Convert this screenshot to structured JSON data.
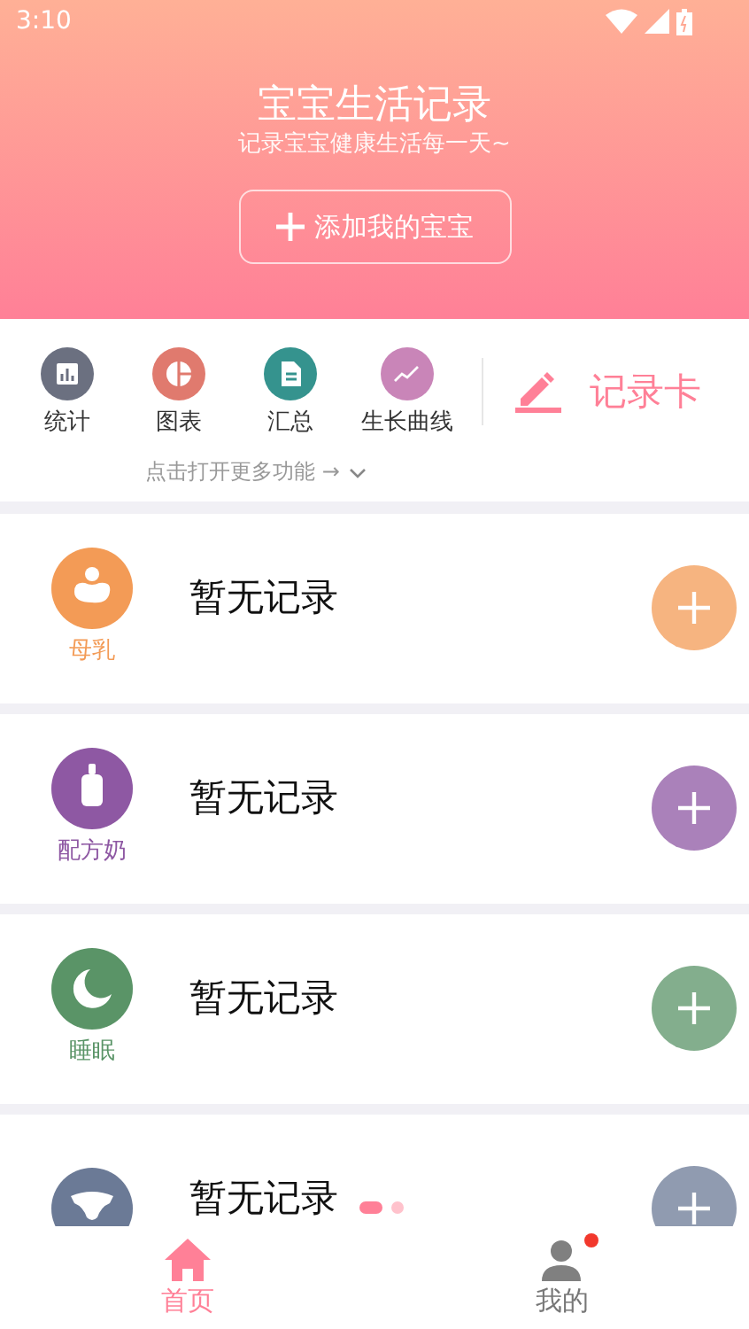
{
  "status_bar": {
    "time": "3:10"
  },
  "header": {
    "title": "宝宝生活记录",
    "subtitle": "记录宝宝健康生活每一天~",
    "add_button": "添加我的宝宝"
  },
  "functions": [
    {
      "label": "统计",
      "kind": "stats",
      "color": "#6b7080"
    },
    {
      "label": "图表",
      "kind": "pie",
      "color": "#e07a6e"
    },
    {
      "label": "汇总",
      "kind": "doc",
      "color": "#35938e"
    },
    {
      "label": "生长曲线",
      "kind": "curve",
      "color": "#c985b8"
    }
  ],
  "record_card": {
    "label": "记录卡"
  },
  "more_hint": "点击打开更多功能 →",
  "records": [
    {
      "kind": "breast",
      "label": "母乳",
      "text": "暂无记录",
      "color": "#f39b56"
    },
    {
      "kind": "formula",
      "label": "配方奶",
      "text": "暂无记录",
      "color": "#8e58a3"
    },
    {
      "kind": "sleep",
      "label": "睡眠",
      "text": "暂无记录",
      "color": "#5a9467"
    },
    {
      "kind": "diaper",
      "text": "暂无记录",
      "color": "#6b7a96"
    }
  ],
  "pager": [
    {
      "selected": true
    },
    {
      "selected": false
    }
  ],
  "nav": [
    {
      "label": "首页",
      "kind": "home",
      "selected": true,
      "badge": false
    },
    {
      "label": "我的",
      "kind": "user",
      "selected": false,
      "badge": true
    }
  ]
}
